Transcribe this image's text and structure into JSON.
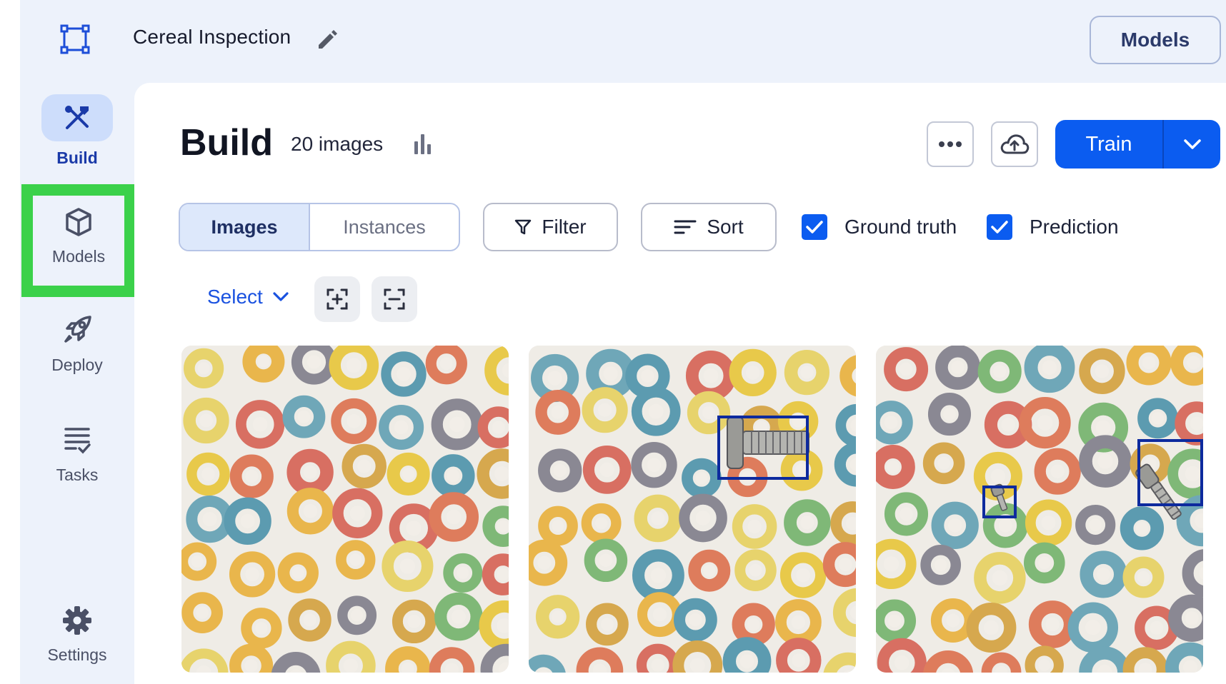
{
  "project": {
    "title": "Cereal Inspection"
  },
  "header": {
    "models_button_label": "Models"
  },
  "sidebar": {
    "items": [
      {
        "label": "Build",
        "icon": "tools-icon",
        "active": true
      },
      {
        "label": "Models",
        "icon": "cube-icon",
        "highlighted": true
      },
      {
        "label": "Deploy",
        "icon": "rocket-icon"
      },
      {
        "label": "Tasks",
        "icon": "tasks-list-icon"
      },
      {
        "label": "Settings",
        "icon": "gear-icon"
      }
    ]
  },
  "build": {
    "title": "Build",
    "image_count": "20 images",
    "train_label": "Train"
  },
  "toolbar": {
    "tabs": [
      "Images",
      "Instances"
    ],
    "filter_label": "Filter",
    "sort_label": "Sort",
    "ground_truth_label": "Ground truth",
    "ground_truth_checked": true,
    "prediction_label": "Prediction",
    "prediction_checked": true,
    "select_label": "Select"
  },
  "colors": {
    "accent": "#0b5cf0",
    "sidebar_active_bg": "#cdddfb",
    "highlight_frame": "#3bd14a",
    "annotation_box": "#0d2a9e"
  },
  "images": [
    {
      "description": "cereal-loops",
      "annotations": 0
    },
    {
      "description": "cereal-loops",
      "annotations": 1
    },
    {
      "description": "cereal-loops",
      "annotations": 2
    }
  ]
}
